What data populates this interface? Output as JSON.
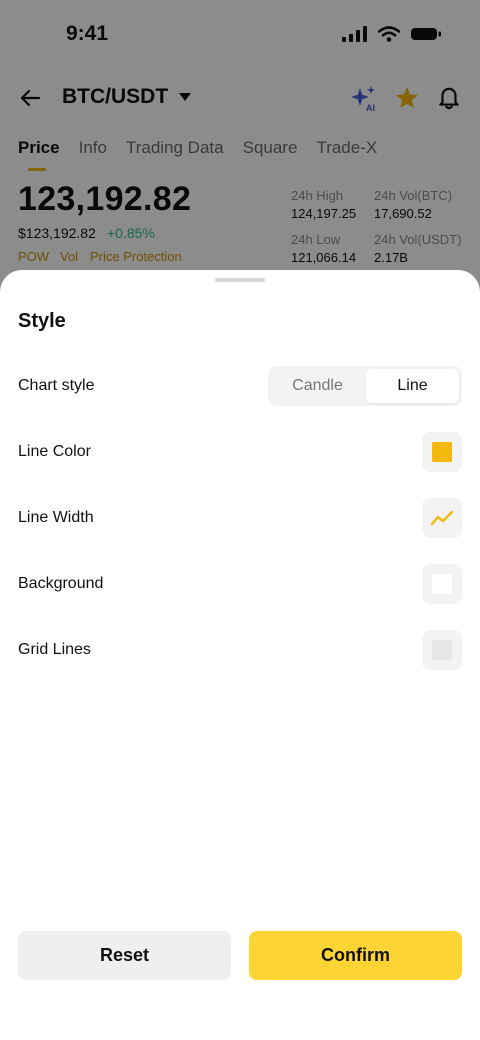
{
  "status_bar": {
    "time": "9:41"
  },
  "header": {
    "pair": "BTC/USDT",
    "ai_badge": "AI"
  },
  "tabs": [
    {
      "label": "Price",
      "active": true
    },
    {
      "label": "Info",
      "active": false
    },
    {
      "label": "Trading Data",
      "active": false
    },
    {
      "label": "Square",
      "active": false
    },
    {
      "label": "Trade-X",
      "active": false
    }
  ],
  "ticker": {
    "last_price": "123,192.82",
    "fiat_price": "$123,192.82",
    "change": "+0.85%",
    "tags": [
      "POW",
      "Vol",
      "Price Protection"
    ],
    "stats": {
      "high_label": "24h High",
      "high_value": "124,197.25",
      "vol_btc_label": "24h Vol(BTC)",
      "vol_btc_value": "17,690.52",
      "low_label": "24h Low",
      "low_value": "121,066.14",
      "vol_usdt_label": "24h Vol(USDT)",
      "vol_usdt_value": "2.17B"
    }
  },
  "sheet": {
    "title": "Style",
    "chart_style": {
      "label": "Chart style",
      "options": [
        "Candle",
        "Line"
      ],
      "selected": "Line"
    },
    "line_color": {
      "label": "Line Color",
      "value": "#f0b90b"
    },
    "line_width": {
      "label": "Line Width"
    },
    "background": {
      "label": "Background",
      "value": "#ffffff"
    },
    "grid_lines": {
      "label": "Grid Lines"
    },
    "reset_label": "Reset",
    "confirm_label": "Confirm"
  },
  "colors": {
    "accent": "#f0b90b",
    "confirm": "#fcd535",
    "positive": "#2ebd85",
    "ai": "#4a5bd4"
  }
}
